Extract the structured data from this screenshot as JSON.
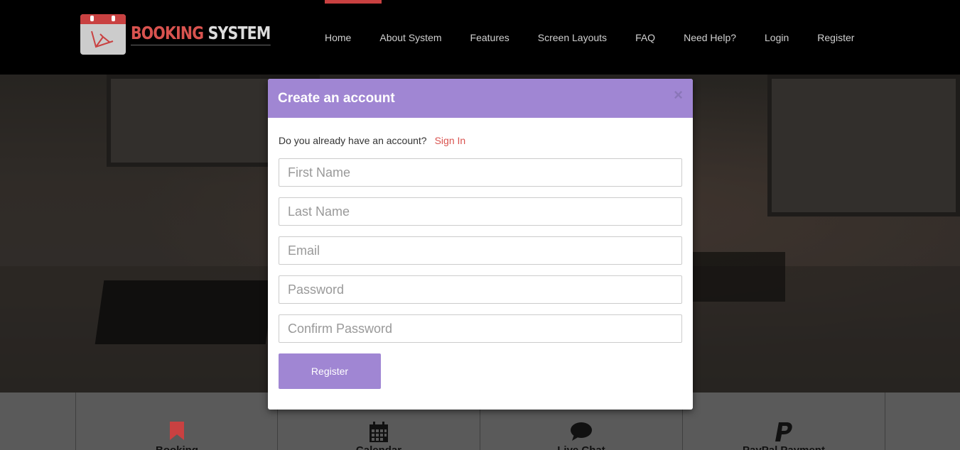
{
  "header": {
    "logo": {
      "word1": "BOOKING",
      "word2": "SYSTEM"
    },
    "nav": [
      {
        "label": "Home",
        "name": "nav-home"
      },
      {
        "label": "About System",
        "name": "nav-about-system"
      },
      {
        "label": "Features",
        "name": "nav-features"
      },
      {
        "label": "Screen Layouts",
        "name": "nav-screen-layouts"
      },
      {
        "label": "FAQ",
        "name": "nav-faq"
      },
      {
        "label": "Need Help?",
        "name": "nav-need-help"
      },
      {
        "label": "Login",
        "name": "nav-login"
      },
      {
        "label": "Register",
        "name": "nav-register"
      }
    ],
    "accent_color": "#c94141"
  },
  "modal": {
    "title": "Create an account",
    "close_symbol": "×",
    "account_prompt": "Do you already have an account?",
    "sign_in_link": "Sign In",
    "fields": {
      "first_name_placeholder": "First Name",
      "last_name_placeholder": "Last Name",
      "email_placeholder": "Email",
      "password_placeholder": "Password",
      "confirm_password_placeholder": "Confirm Password"
    },
    "register_button": "Register",
    "header_color": "#a086d3"
  },
  "features": [
    {
      "label": "Booking",
      "icon": "bookmark-icon"
    },
    {
      "label": "Calendar",
      "icon": "calendar-icon"
    },
    {
      "label": "Live Chat",
      "icon": "chat-bubble-icon"
    },
    {
      "label": "PayPal Payment",
      "icon": "paypal-icon"
    }
  ]
}
